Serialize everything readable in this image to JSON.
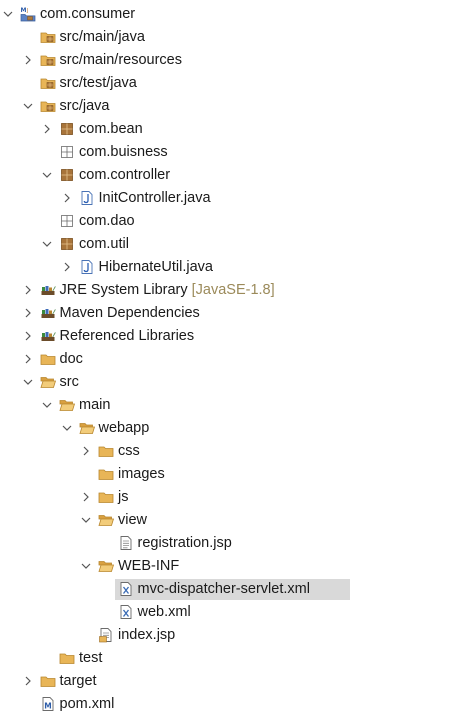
{
  "tree": [
    {
      "level": 0,
      "toggle": "expanded",
      "icon": "maven-project",
      "label": "com.consumer"
    },
    {
      "level": 1,
      "toggle": "none",
      "icon": "source-folder",
      "label": "src/main/java"
    },
    {
      "level": 1,
      "toggle": "collapsed",
      "icon": "source-folder",
      "label": "src/main/resources"
    },
    {
      "level": 1,
      "toggle": "none",
      "icon": "source-folder",
      "label": "src/test/java"
    },
    {
      "level": 1,
      "toggle": "expanded",
      "icon": "source-folder",
      "label": "src/java"
    },
    {
      "level": 2,
      "toggle": "collapsed",
      "icon": "package",
      "label": "com.bean"
    },
    {
      "level": 2,
      "toggle": "none",
      "icon": "package-empty",
      "label": "com.buisness"
    },
    {
      "level": 2,
      "toggle": "expanded",
      "icon": "package",
      "label": "com.controller"
    },
    {
      "level": 3,
      "toggle": "collapsed",
      "icon": "java-file",
      "label": "InitController.java"
    },
    {
      "level": 2,
      "toggle": "none",
      "icon": "package-empty",
      "label": "com.dao"
    },
    {
      "level": 2,
      "toggle": "expanded",
      "icon": "package",
      "label": "com.util"
    },
    {
      "level": 3,
      "toggle": "collapsed",
      "icon": "java-file",
      "label": "HibernateUtil.java"
    },
    {
      "level": 1,
      "toggle": "collapsed",
      "icon": "library",
      "label": "JRE System Library",
      "decoration": "[JavaSE-1.8]"
    },
    {
      "level": 1,
      "toggle": "collapsed",
      "icon": "library",
      "label": "Maven Dependencies"
    },
    {
      "level": 1,
      "toggle": "collapsed",
      "icon": "library",
      "label": "Referenced Libraries"
    },
    {
      "level": 1,
      "toggle": "collapsed",
      "icon": "folder",
      "label": "doc"
    },
    {
      "level": 1,
      "toggle": "expanded",
      "icon": "folder-open",
      "label": "src"
    },
    {
      "level": 2,
      "toggle": "expanded",
      "icon": "folder-open",
      "label": "main"
    },
    {
      "level": 3,
      "toggle": "expanded",
      "icon": "folder-open",
      "label": "webapp"
    },
    {
      "level": 4,
      "toggle": "collapsed",
      "icon": "folder",
      "label": "css"
    },
    {
      "level": 4,
      "toggle": "none",
      "icon": "folder",
      "label": "images"
    },
    {
      "level": 4,
      "toggle": "collapsed",
      "icon": "folder",
      "label": "js"
    },
    {
      "level": 4,
      "toggle": "expanded",
      "icon": "folder-open",
      "label": "view"
    },
    {
      "level": 5,
      "toggle": "none",
      "icon": "text-file",
      "label": "registration.jsp"
    },
    {
      "level": 4,
      "toggle": "expanded",
      "icon": "folder-open",
      "label": "WEB-INF"
    },
    {
      "level": 5,
      "toggle": "none",
      "icon": "xml-file",
      "label": "mvc-dispatcher-servlet.xml",
      "selected": true
    },
    {
      "level": 5,
      "toggle": "none",
      "icon": "xml-file",
      "label": "web.xml"
    },
    {
      "level": 4,
      "toggle": "none",
      "icon": "jsp-file",
      "label": "index.jsp"
    },
    {
      "level": 2,
      "toggle": "none",
      "icon": "folder",
      "label": "test"
    },
    {
      "level": 1,
      "toggle": "collapsed",
      "icon": "folder",
      "label": "target"
    },
    {
      "level": 1,
      "toggle": "none",
      "icon": "maven-pom",
      "label": "pom.xml"
    }
  ],
  "colors": {
    "selection": "#d9d9d9",
    "chevron": "#555555",
    "folder": "#e8b557",
    "package": "#a8743a",
    "decoration": "#9b8a5a"
  }
}
